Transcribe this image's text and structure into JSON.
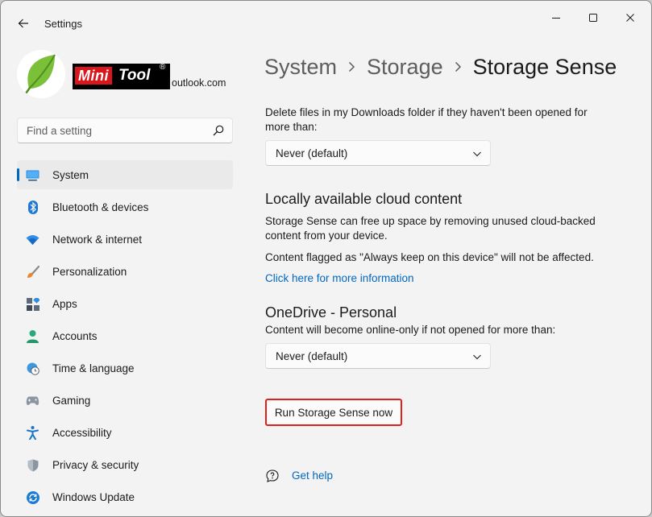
{
  "window": {
    "title": "Settings"
  },
  "account": {
    "email_suffix": "outlook.com",
    "logo": {
      "word1": "Mini",
      "word2": "Tool",
      "mark": "®"
    }
  },
  "search": {
    "placeholder": "Find a setting",
    "value": ""
  },
  "sidebar": {
    "items": [
      {
        "label": "System",
        "icon": "system-icon",
        "selected": true
      },
      {
        "label": "Bluetooth & devices",
        "icon": "bluetooth-icon"
      },
      {
        "label": "Network & internet",
        "icon": "wifi-icon"
      },
      {
        "label": "Personalization",
        "icon": "brush-icon"
      },
      {
        "label": "Apps",
        "icon": "apps-icon"
      },
      {
        "label": "Accounts",
        "icon": "person-icon"
      },
      {
        "label": "Time & language",
        "icon": "globe-clock-icon"
      },
      {
        "label": "Gaming",
        "icon": "gamepad-icon"
      },
      {
        "label": "Accessibility",
        "icon": "accessibility-icon"
      },
      {
        "label": "Privacy & security",
        "icon": "shield-icon"
      },
      {
        "label": "Windows Update",
        "icon": "update-icon"
      }
    ]
  },
  "breadcrumb": [
    "System",
    "Storage",
    "Storage Sense"
  ],
  "content": {
    "downloads_desc_line1": "Delete files in my Downloads folder if they haven't been opened for",
    "downloads_desc_line2": "more than:",
    "downloads_dropdown": "Never (default)",
    "cloud_heading": "Locally available cloud content",
    "cloud_desc_line1": "Storage Sense can free up space by removing unused cloud-backed",
    "cloud_desc_line2": "content from your device.",
    "cloud_note": "Content flagged as \"Always keep on this device\" will not be affected.",
    "cloud_link": "Click here for more information",
    "onedrive_heading": "OneDrive - Personal",
    "onedrive_desc": "Content will become online-only if not opened for more than:",
    "onedrive_dropdown": "Never (default)",
    "run_button": "Run Storage Sense now",
    "help_link": "Get help"
  },
  "colors": {
    "accent": "#0067c0",
    "highlight_box": "#e0201b",
    "logo_red": "#d8161c"
  }
}
